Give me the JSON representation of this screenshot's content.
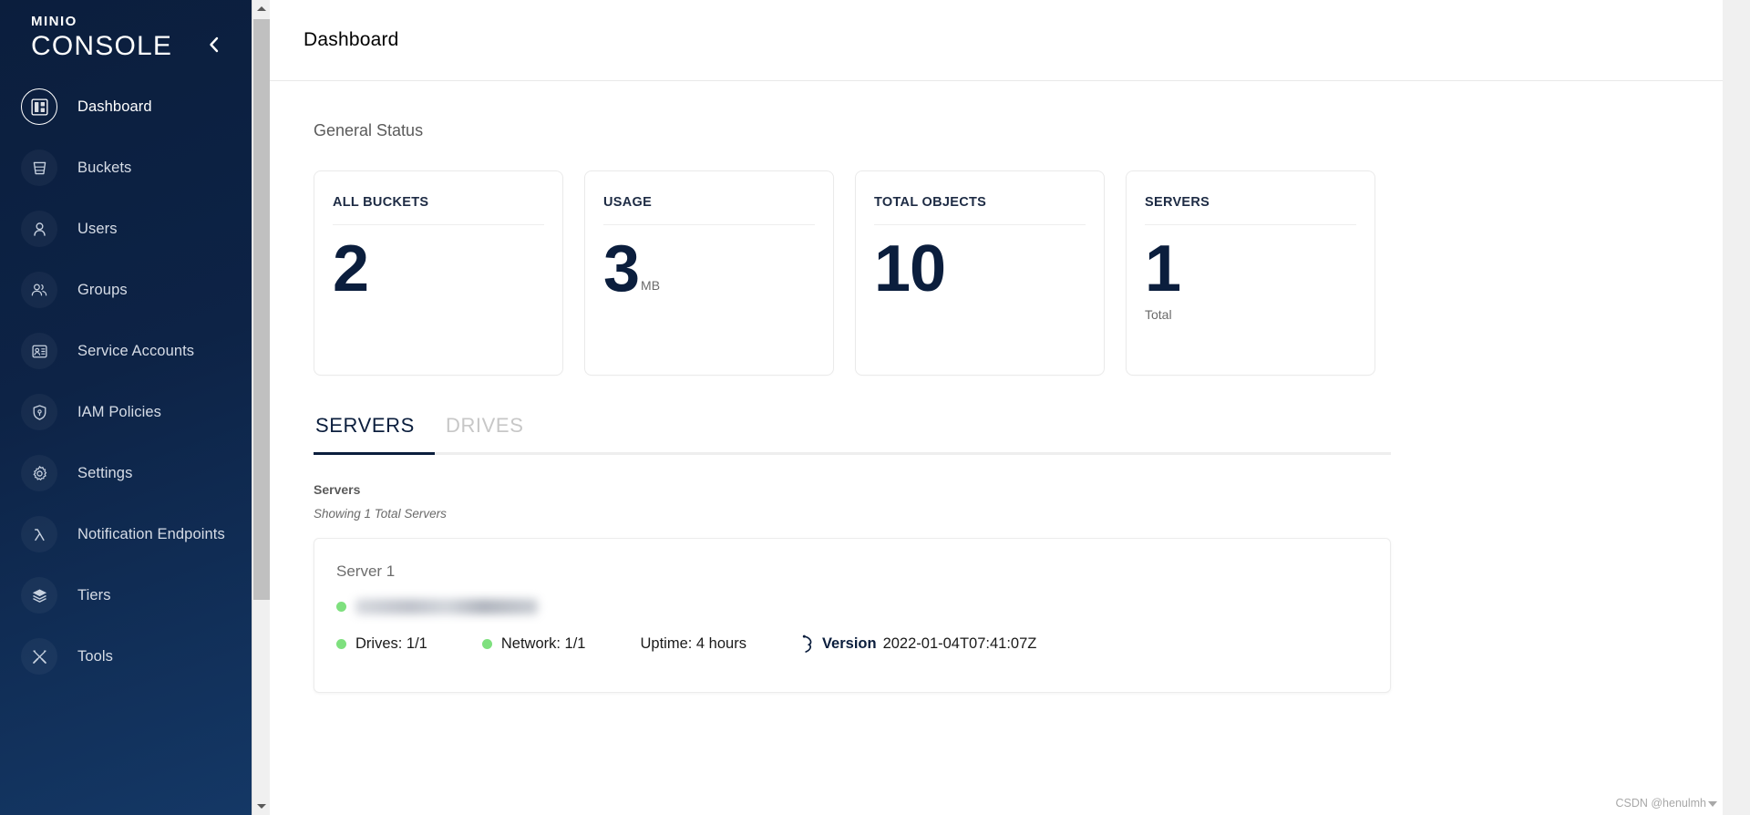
{
  "brand": {
    "mini": "MINIO",
    "console": "CONSOLE",
    "collapse_icon": "chevron-left-icon"
  },
  "sidebar": {
    "items": [
      {
        "label": "Dashboard",
        "icon": "dashboard-icon",
        "active": true
      },
      {
        "label": "Buckets",
        "icon": "bucket-icon",
        "active": false
      },
      {
        "label": "Users",
        "icon": "user-icon",
        "active": false
      },
      {
        "label": "Groups",
        "icon": "groups-icon",
        "active": false
      },
      {
        "label": "Service Accounts",
        "icon": "id-card-icon",
        "active": false
      },
      {
        "label": "IAM Policies",
        "icon": "shield-lock-icon",
        "active": false
      },
      {
        "label": "Settings",
        "icon": "gear-icon",
        "active": false
      },
      {
        "label": "Notification Endpoints",
        "icon": "lambda-icon",
        "active": false
      },
      {
        "label": "Tiers",
        "icon": "layers-icon",
        "active": false
      },
      {
        "label": "Tools",
        "icon": "tools-icon",
        "active": false
      }
    ]
  },
  "header": {
    "title": "Dashboard"
  },
  "general_status": {
    "section_label": "General Status",
    "cards": [
      {
        "label": "ALL BUCKETS",
        "value": "2",
        "unit": "",
        "sub": ""
      },
      {
        "label": "USAGE",
        "value": "3",
        "unit": "MB",
        "sub": ""
      },
      {
        "label": "TOTAL OBJECTS",
        "value": "10",
        "unit": "",
        "sub": ""
      },
      {
        "label": "SERVERS",
        "value": "1",
        "unit": "",
        "sub": "Total"
      }
    ]
  },
  "tabs": {
    "items": [
      {
        "label": "SERVERS",
        "active": true
      },
      {
        "label": "DRIVES",
        "active": false
      }
    ]
  },
  "servers_panel": {
    "heading": "Servers",
    "subtitle": "Showing 1 Total Servers",
    "server": {
      "name": "Server 1",
      "address_redacted": "",
      "status_color": "#7ee07e",
      "drives": "Drives: 1/1",
      "network": "Network: 1/1",
      "uptime": "Uptime: 4 hours",
      "version_label": "Version",
      "version_value": "2022-01-04T07:41:07Z",
      "version_icon": "minio-bird-icon"
    }
  },
  "watermark": {
    "text": "CSDN @henulmh"
  },
  "colors": {
    "sidebar_dark": "#0b1e3d",
    "accent_navy": "#0b1e3d",
    "status_green": "#7ee07e",
    "card_border": "#eaeaea"
  }
}
